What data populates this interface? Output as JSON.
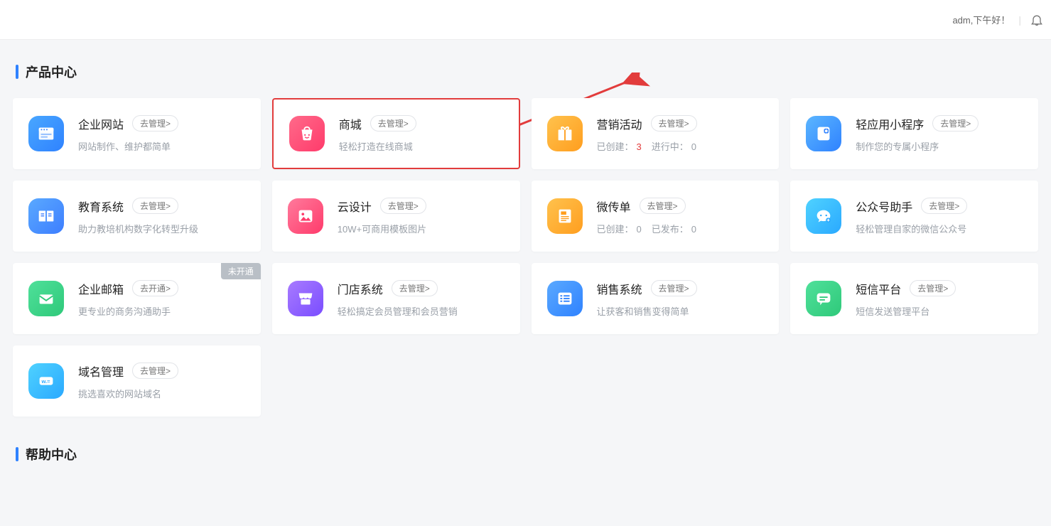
{
  "header": {
    "greeting": "adm,下午好！"
  },
  "sections": {
    "products_title": "产品中心",
    "help_title": "帮助中心"
  },
  "pill_label": "去管理>",
  "pill_open_label": "去开通>",
  "badge_not_open": "未开通",
  "cards": [
    {
      "title": "企业网站",
      "desc": "网站制作、维护都简单"
    },
    {
      "title": "商城",
      "desc": "轻松打造在线商城"
    },
    {
      "title": "营销活动",
      "desc_created_label": "已创建：",
      "desc_created_count": "3",
      "desc_running_label": "进行中：",
      "desc_running_count": "0"
    },
    {
      "title": "轻应用小程序",
      "desc": "制作您的专属小程序"
    },
    {
      "title": "教育系统",
      "desc": "助力教培机构数字化转型升级"
    },
    {
      "title": "云设计",
      "desc": "10W+可商用模板图片"
    },
    {
      "title": "微传单",
      "desc_created_label": "已创建：",
      "desc_created_count": "0",
      "desc_pub_label": "已发布：",
      "desc_pub_count": "0"
    },
    {
      "title": "公众号助手",
      "desc": "轻松管理自家的微信公众号"
    },
    {
      "title": "企业邮箱",
      "desc": "更专业的商务沟通助手"
    },
    {
      "title": "门店系统",
      "desc": "轻松搞定会员管理和会员营销"
    },
    {
      "title": "销售系统",
      "desc": "让获客和销售变得简单"
    },
    {
      "title": "短信平台",
      "desc": "短信发送管理平台"
    },
    {
      "title": "域名管理",
      "desc": "挑选喜欢的网站域名"
    }
  ]
}
